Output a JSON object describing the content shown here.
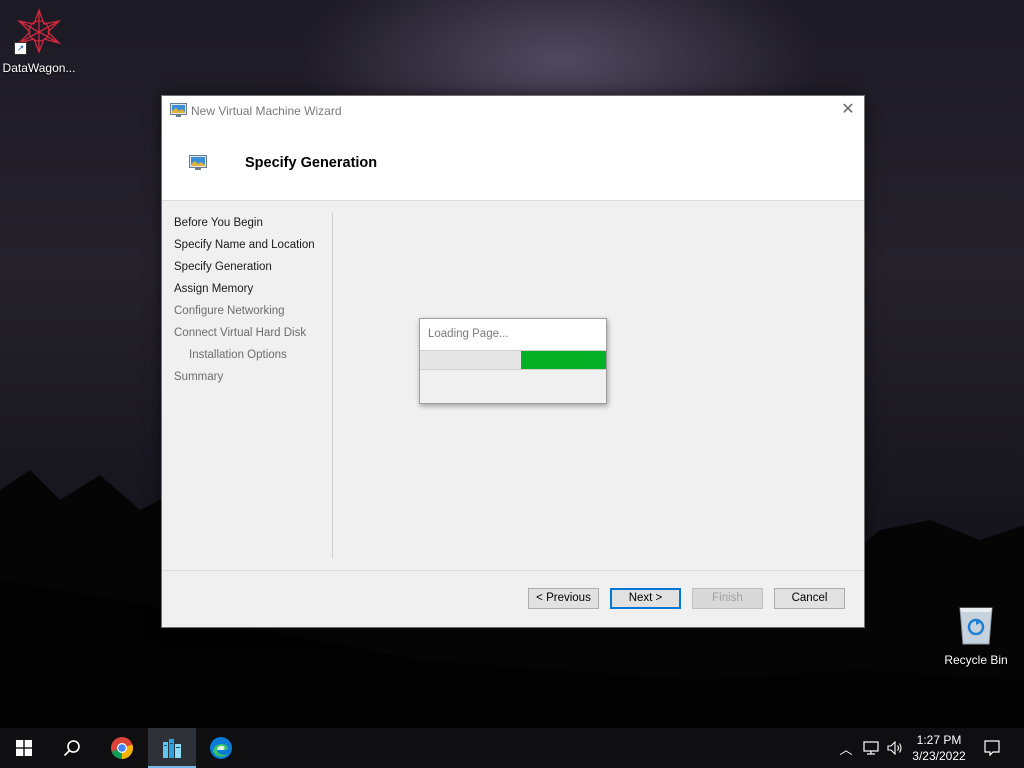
{
  "desktop": {
    "icons": [
      {
        "label": "DataWagon..."
      },
      {
        "label": "Recycle Bin"
      }
    ]
  },
  "window": {
    "title": "New Virtual Machine Wizard",
    "page_title": "Specify Generation",
    "steps": [
      {
        "label": "Before You Begin",
        "enabled": true
      },
      {
        "label": "Specify Name and Location",
        "enabled": true
      },
      {
        "label": "Specify Generation",
        "enabled": true
      },
      {
        "label": "Assign Memory",
        "enabled": true
      },
      {
        "label": "Configure Networking",
        "enabled": false
      },
      {
        "label": "Connect Virtual Hard Disk",
        "enabled": false
      },
      {
        "label": "Installation Options",
        "enabled": false
      },
      {
        "label": "Summary",
        "enabled": false
      }
    ],
    "buttons": {
      "previous": "< Previous",
      "next": "Next >",
      "finish": "Finish",
      "cancel": "Cancel"
    },
    "loading": {
      "text": "Loading Page...",
      "progress_color": "#06b025"
    }
  },
  "taskbar": {
    "time": "1:27 PM",
    "date": "3/23/2022",
    "apps": [
      "start-icon",
      "search-icon",
      "chrome-icon",
      "server-manager-icon",
      "edge-icon"
    ],
    "accent": "#76b9ed"
  }
}
